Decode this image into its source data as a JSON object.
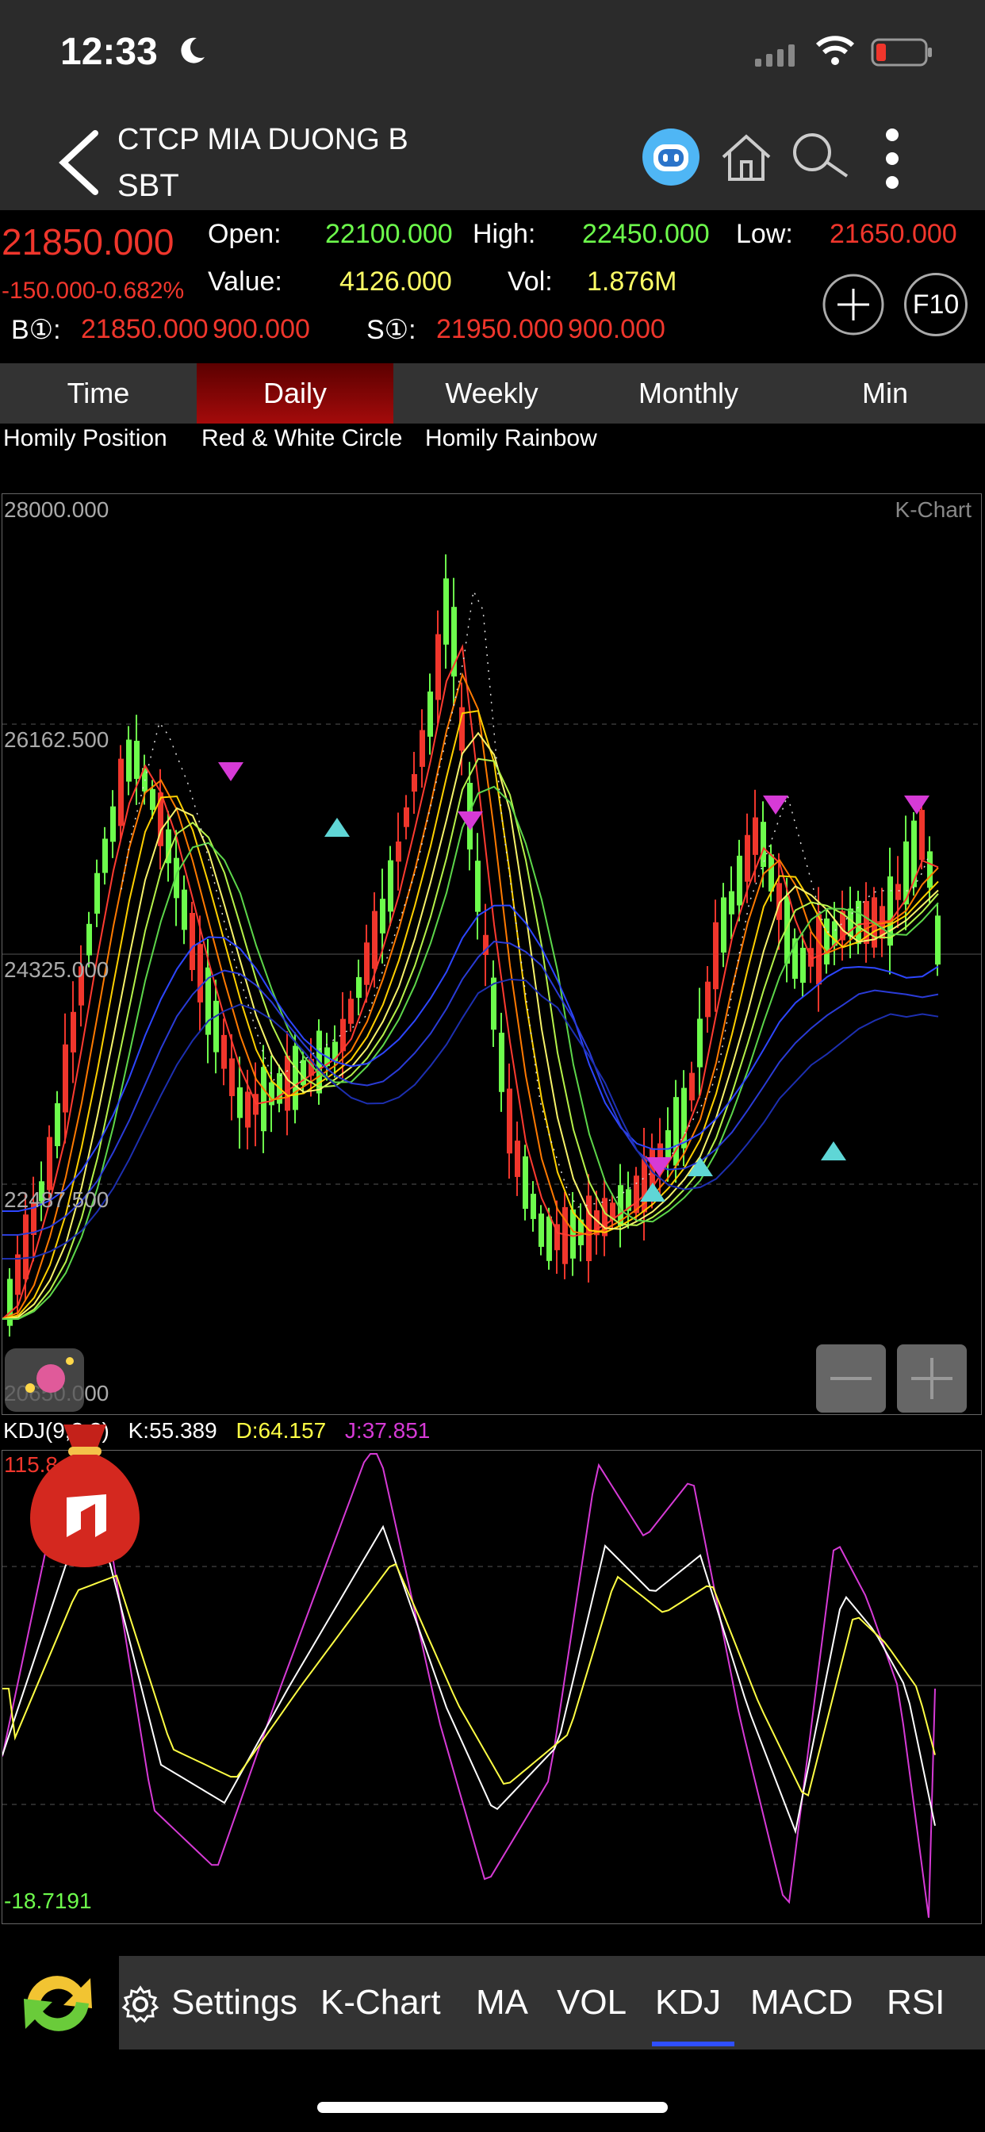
{
  "status_bar": {
    "time": "12:33"
  },
  "header": {
    "company": "CTCP MIA DUONG B",
    "symbol": "SBT"
  },
  "quote": {
    "price": "21850.000",
    "change": "-150.000",
    "change_pct": "-0.682%",
    "open_label": "Open:",
    "open": "22100.000",
    "high_label": "High:",
    "high": "22450.000",
    "low_label": "Low:",
    "low": "21650.000",
    "value_label": "Value:",
    "value": "4126.000",
    "vol_label": "Vol:",
    "vol": "1.876M",
    "bid_label": "B①:",
    "bid_price": "21850.000",
    "bid_qty": "900.000",
    "ask_label": "S①:",
    "ask_price": "21950.000",
    "ask_qty": "900.000",
    "f10_label": "F10"
  },
  "tabs": [
    "Time",
    "Daily",
    "Weekly",
    "Monthly",
    "Min"
  ],
  "active_tab": "Daily",
  "indicators": [
    "Homily Position",
    "Red & White Circle",
    "Homily Rainbow"
  ],
  "kchart": {
    "label": "K-Chart",
    "levels": [
      "28000.000",
      "26162.500",
      "24325.000",
      "22487.500",
      "20650.000"
    ]
  },
  "kdj": {
    "label": "KDJ(9,3,3)",
    "k": "K:55.389",
    "d": "D:64.157",
    "j": "J:37.851",
    "max": "115.8",
    "min": "-18.7191"
  },
  "toolbar": [
    "Settings",
    "K-Chart",
    "MA",
    "VOL",
    "KDJ",
    "MACD",
    "RSI"
  ],
  "active_indicator": "KDJ",
  "colors": {
    "up": "#6dfc4c",
    "down": "#f0362c",
    "k_line": "#ffffff",
    "d_line": "#ffff44",
    "j_line": "#d63ad6",
    "accent": "#2f4fff"
  }
}
